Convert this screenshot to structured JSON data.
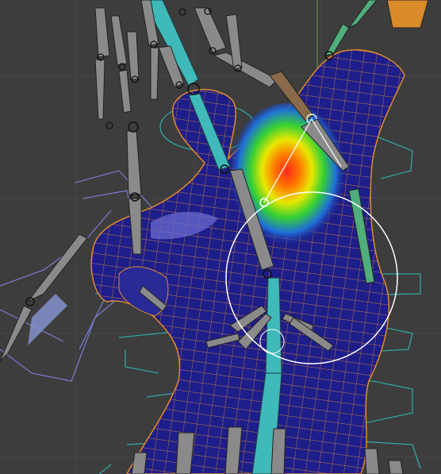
{
  "viewport": {
    "mode": "weight-paint",
    "background_color": "#3d3d3d",
    "grid_color": "#474747",
    "mesh_fill_color": "#1e1e8a",
    "wire_color": "#e08a2a",
    "bone_color": "#8a8a8a",
    "active_bone_color": "#3fb9b9",
    "cage_color": "#2fa6a6",
    "hand_cage_color": "#7b7bd6",
    "brush_circle_color": "#ffffff",
    "heat_colors": [
      "#ff2a1a",
      "#ff8a00",
      "#e8e800",
      "#35d035",
      "#1f6fd9"
    ]
  }
}
